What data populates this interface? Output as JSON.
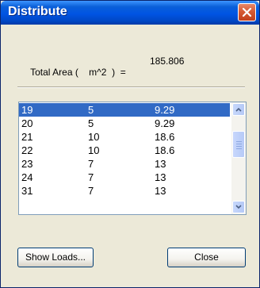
{
  "window": {
    "title": "Distribute"
  },
  "total_area": {
    "label": "Total Area (    m^2  )  =",
    "value": "185.806"
  },
  "list": {
    "rows": [
      {
        "col1": "19",
        "col2": "5",
        "col3": "9.29",
        "selected": true
      },
      {
        "col1": "20",
        "col2": "5",
        "col3": "9.29",
        "selected": false
      },
      {
        "col1": "21",
        "col2": "10",
        "col3": "18.6",
        "selected": false
      },
      {
        "col1": "22",
        "col2": "10",
        "col3": "18.6",
        "selected": false
      },
      {
        "col1": "23",
        "col2": "7",
        "col3": "13",
        "selected": false
      },
      {
        "col1": "24",
        "col2": "7",
        "col3": "13",
        "selected": false
      },
      {
        "col1": "31",
        "col2": "7",
        "col3": "13",
        "selected": false
      }
    ]
  },
  "buttons": {
    "show_loads": "Show Loads...",
    "close": "Close"
  },
  "colors": {
    "titlebar": "#0054e3",
    "selection": "#316ac5",
    "dialog_bg": "#ece9d8"
  }
}
